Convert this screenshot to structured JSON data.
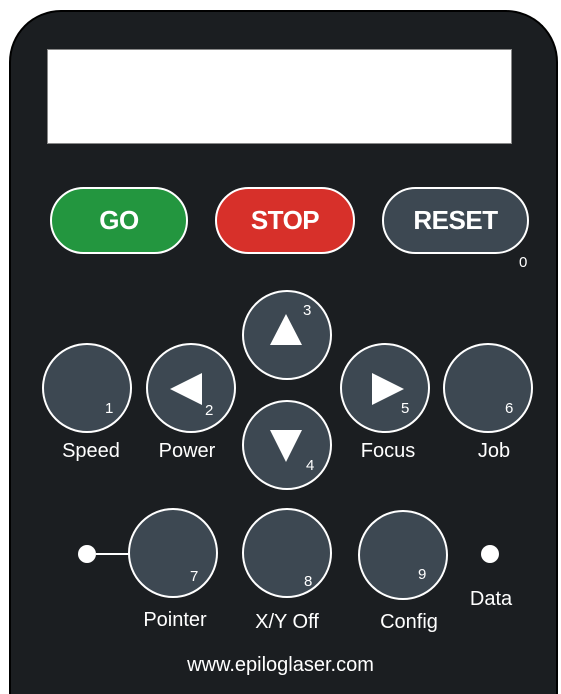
{
  "colors": {
    "panel": "#1b1e21",
    "button_gray": "#3d4852",
    "go": "#23963f",
    "stop": "#d7302a",
    "reset": "#3d4852",
    "text": "#ffffff"
  },
  "display": {
    "text": ""
  },
  "buttons": {
    "go": {
      "label": "GO"
    },
    "stop": {
      "label": "STOP"
    },
    "reset": {
      "label": "RESET",
      "number": "0"
    },
    "speed": {
      "label": "Speed",
      "number": "1"
    },
    "power": {
      "label": "Power",
      "number": "2",
      "icon": "arrow-left-icon"
    },
    "up": {
      "number": "3",
      "icon": "arrow-up-icon"
    },
    "down": {
      "number": "4",
      "icon": "arrow-down-icon"
    },
    "focus": {
      "label": "Focus",
      "number": "5",
      "icon": "arrow-right-icon"
    },
    "job": {
      "label": "Job",
      "number": "6"
    },
    "pointer": {
      "label": "Pointer",
      "number": "7"
    },
    "xyoff": {
      "label": "X/Y Off",
      "number": "8"
    },
    "config": {
      "label": "Config",
      "number": "9"
    }
  },
  "indicators": {
    "data": {
      "label": "Data"
    }
  },
  "footer": {
    "url": "www.epiloglaser.com"
  }
}
